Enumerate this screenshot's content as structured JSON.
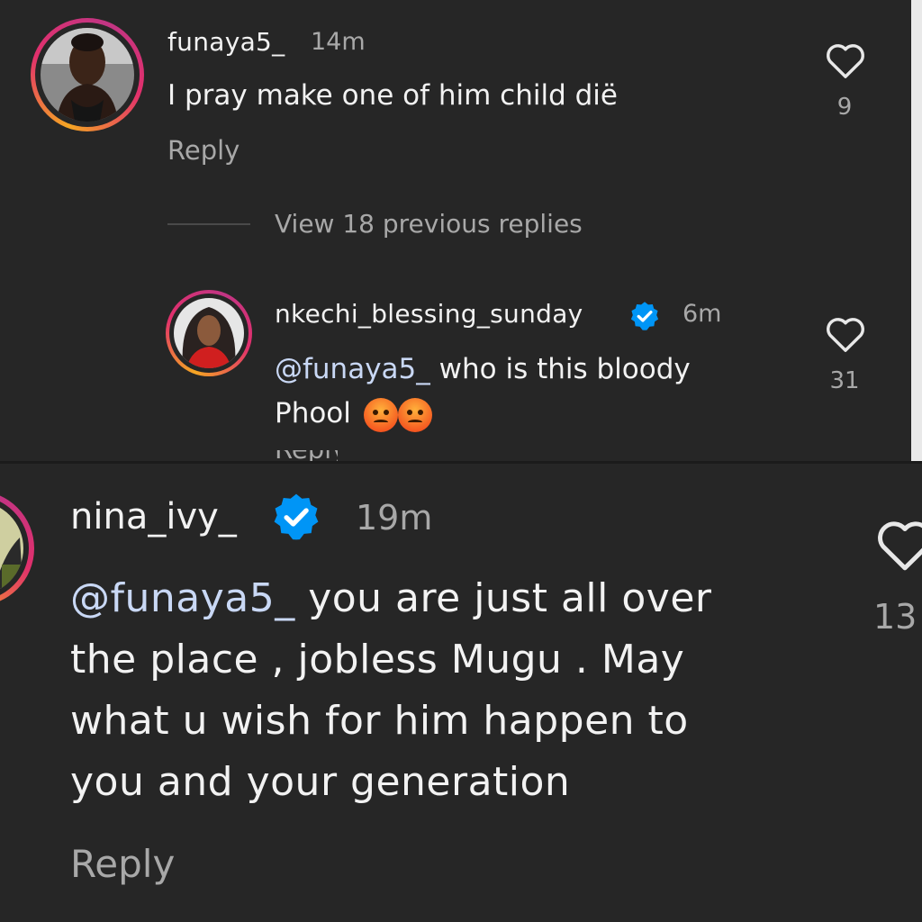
{
  "comments": [
    {
      "username": "funaya5_",
      "time": "14m",
      "text": "I pray make one of him child dië",
      "reply_label": "Reply",
      "likes": "9"
    }
  ],
  "view_previous": "View 18 previous replies",
  "replies": [
    {
      "username": "nkechi_blessing_sunday",
      "time": "6m",
      "mention": "@funaya5_",
      "text_line1": " who is this bloody",
      "text_line2": "Phool",
      "likes": "31",
      "reply_label": "Reply"
    }
  ],
  "zoomed_comment": {
    "username": "nina_ivy_",
    "time": "19m",
    "mention": "@funaya5_",
    "line1": " you are just all over",
    "line2": "the place , jobless Mugu . May",
    "line3": "what u wish for him happen to",
    "line4": "you and your generation",
    "reply_label": "Reply",
    "likes": "13"
  },
  "icons": {
    "heart": "heart-outline-icon",
    "verified": "verified-badge-icon",
    "emoji": "angry-face-emoji"
  },
  "colors": {
    "background": "#262626",
    "text": "#f2f2f2",
    "muted": "#a8a8a8",
    "verified": "#0095f6"
  }
}
